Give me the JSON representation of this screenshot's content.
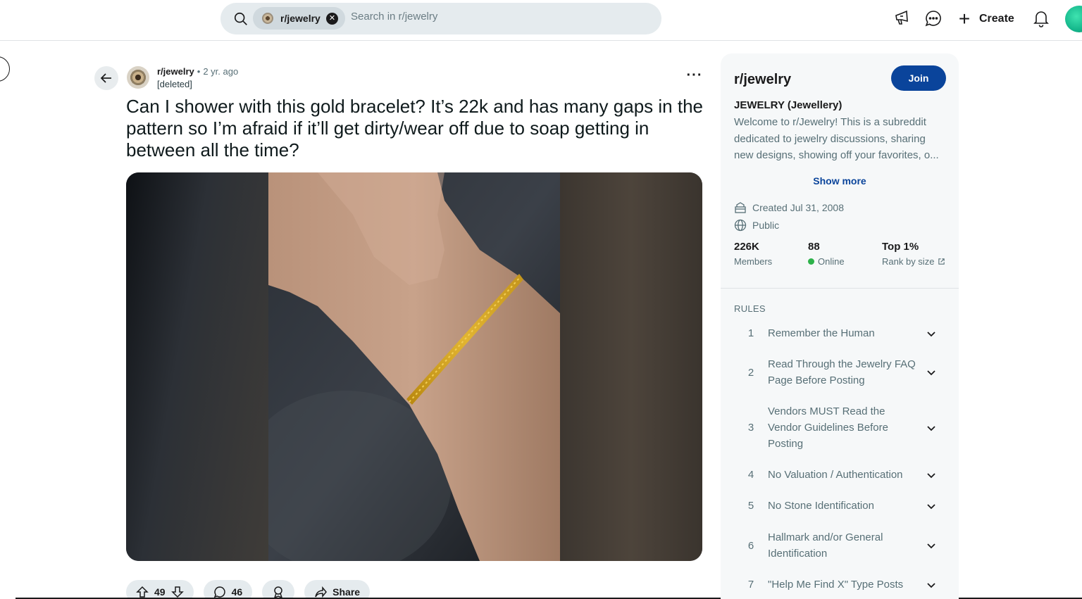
{
  "header": {
    "search_chip": "r/jewelry",
    "search_placeholder": "Search in r/jewelry",
    "create_label": "Create"
  },
  "post": {
    "subreddit": "r/jewelry",
    "separator": "•",
    "time": "2 yr. ago",
    "author": "[deleted]",
    "title": "Can I shower with this gold bracelet? It’s 22k and has many gaps in the pattern so I’m afraid if it’ll get dirty/wear off due to soap getting in between all the time?",
    "votes": "49",
    "comments": "46",
    "share_label": "Share"
  },
  "sidebar": {
    "title": "r/jewelry",
    "join_label": "Join",
    "heading": "JEWELRY (Jewellery)",
    "description": "Welcome to r/Jewelry! This is a subreddit dedicated to jewelry discussions, sharing new designs, showing off your favorites, o...",
    "show_more": "Show more",
    "created": "Created Jul 31, 2008",
    "visibility": "Public",
    "stats": [
      {
        "value": "226K",
        "label": "Members"
      },
      {
        "value": "88",
        "label": "Online"
      },
      {
        "value": "Top 1%",
        "label": "Rank by size"
      }
    ],
    "rules_heading": "RULES",
    "rules": [
      {
        "num": "1",
        "text": "Remember the Human"
      },
      {
        "num": "2",
        "text": "Read Through the Jewelry FAQ Page Before Posting"
      },
      {
        "num": "3",
        "text": "Vendors MUST Read the Vendor Guidelines Before Posting"
      },
      {
        "num": "4",
        "text": "No Valuation / Authentication"
      },
      {
        "num": "5",
        "text": "No Stone Identification"
      },
      {
        "num": "6",
        "text": "Hallmark and/or General Identification"
      },
      {
        "num": "7",
        "text": "\"Help Me Find X\" Type Posts"
      }
    ]
  }
}
